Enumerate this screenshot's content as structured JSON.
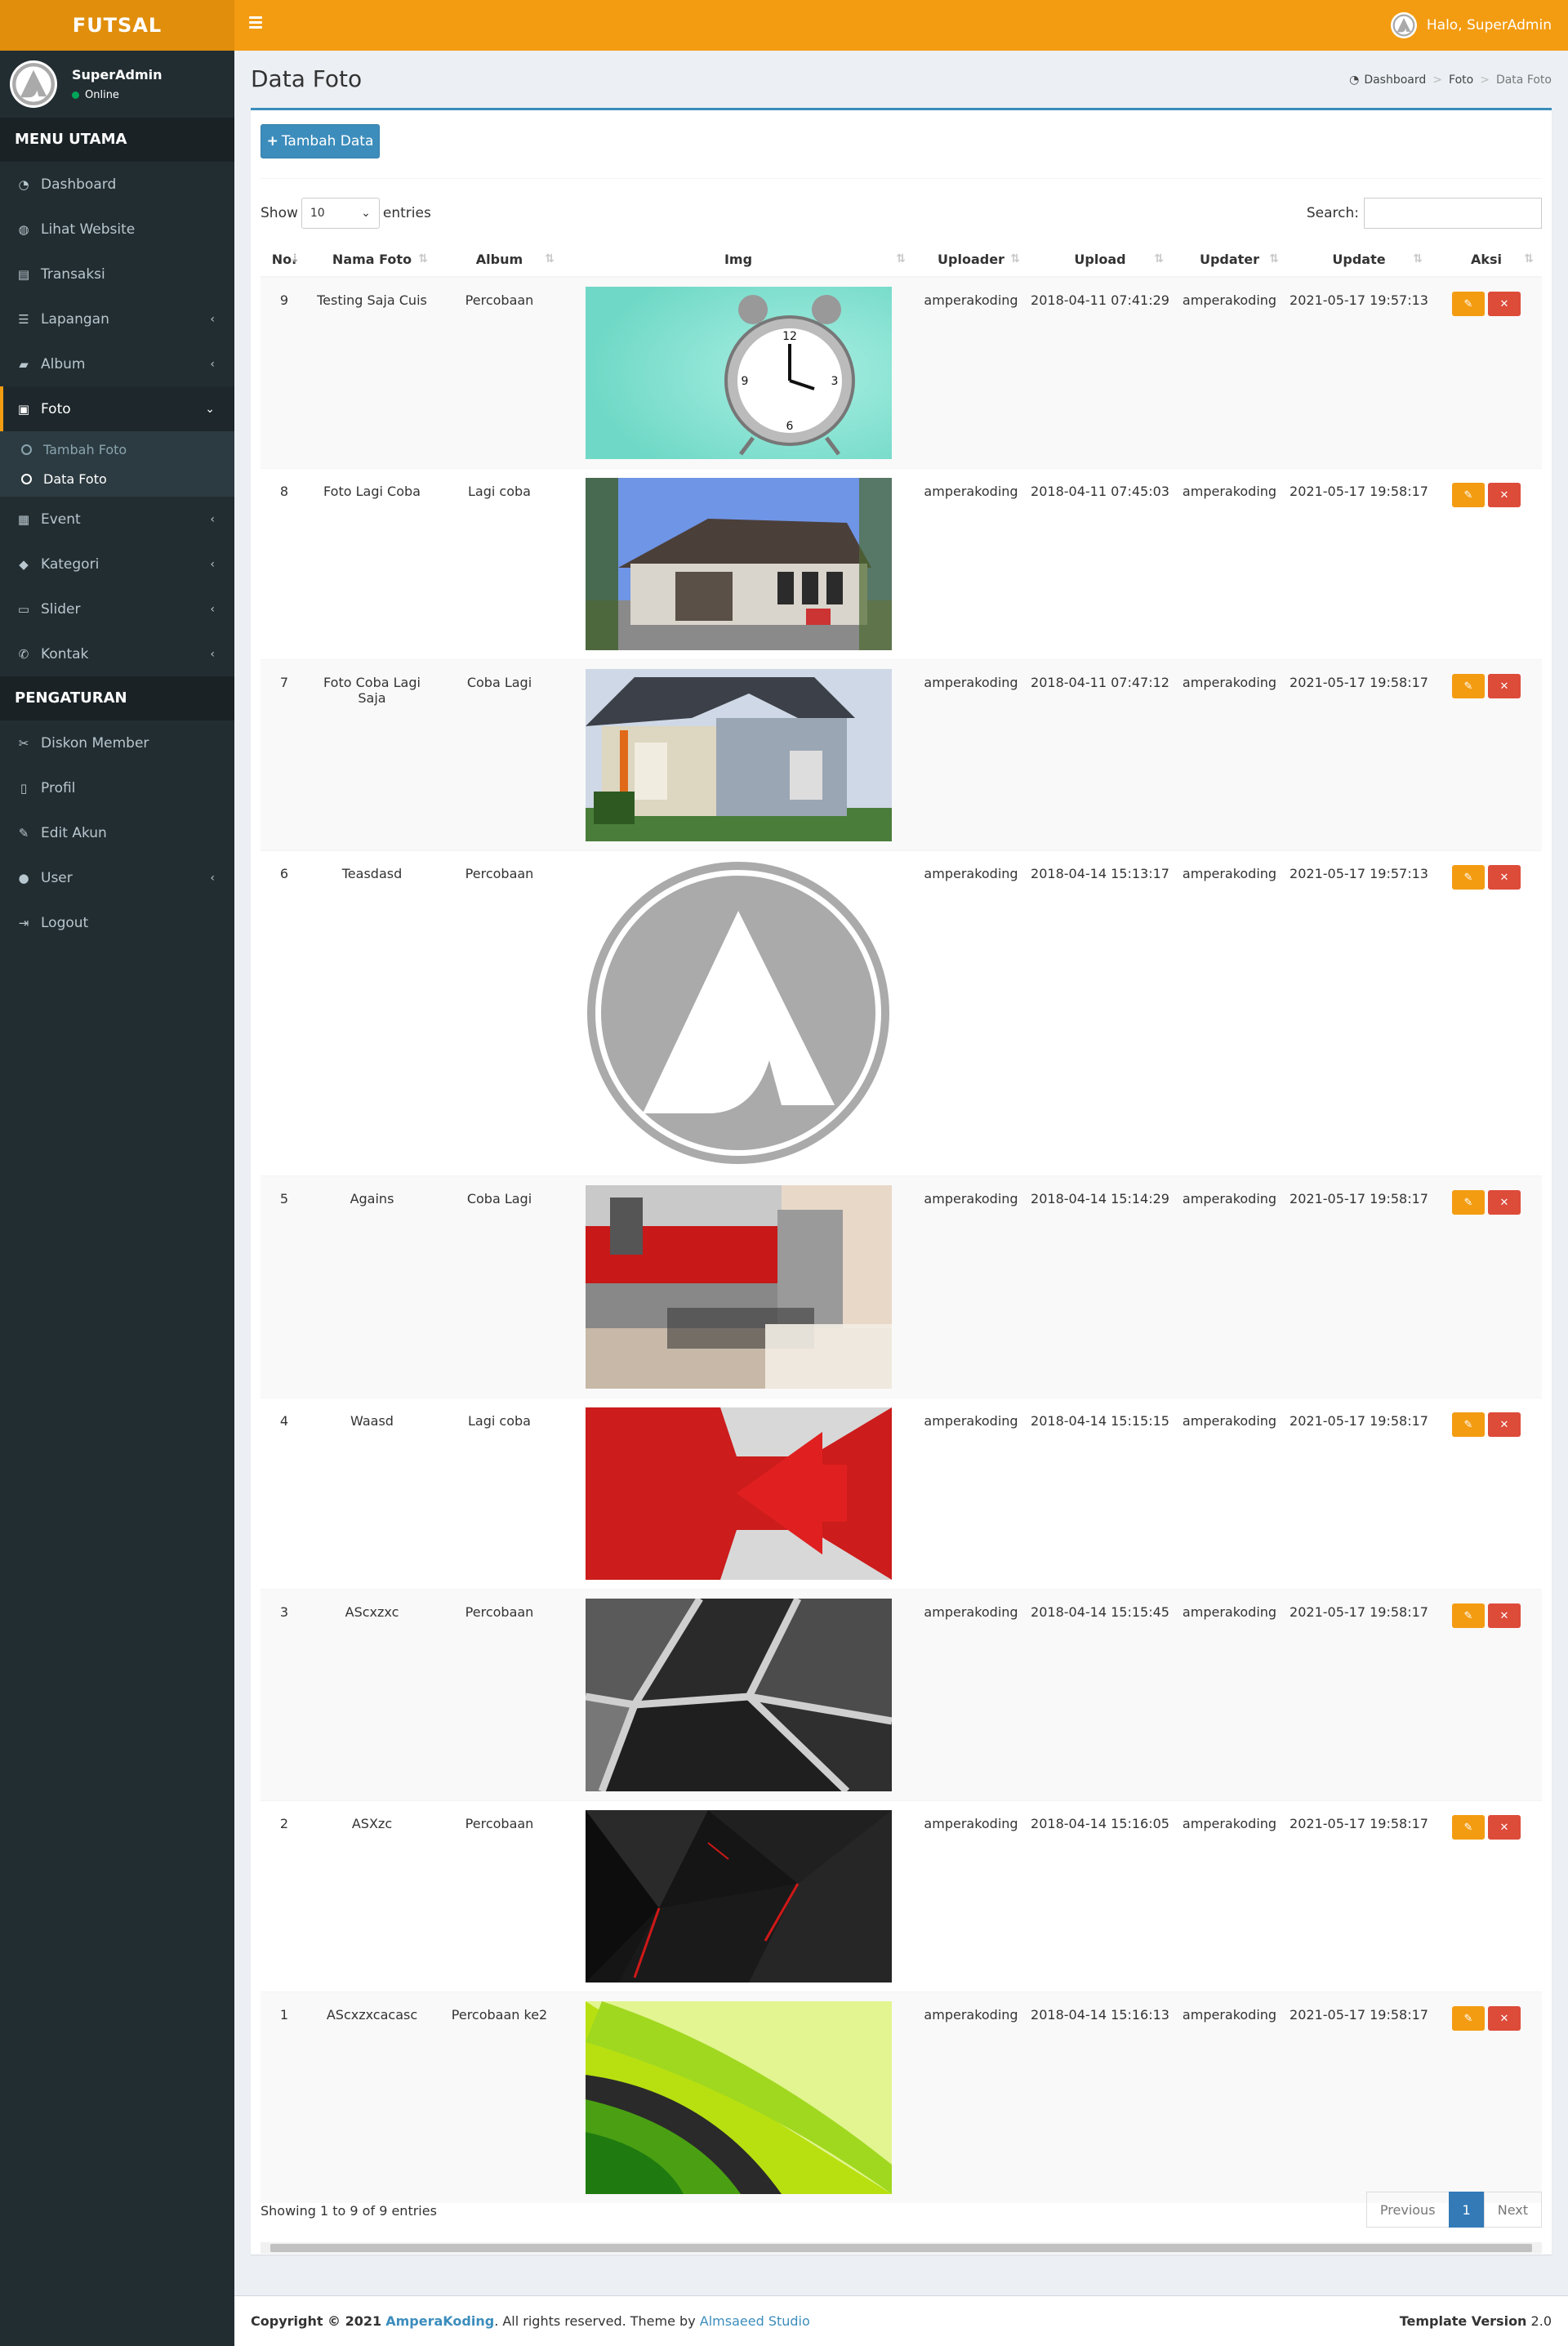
{
  "app": {
    "logo": "FUTSAL",
    "user_greeting": "Halo, SuperAdmin"
  },
  "sidebar": {
    "user_name": "SuperAdmin",
    "user_status": "Online",
    "main_header": "MENU UTAMA",
    "items": [
      {
        "label": "Dashboard",
        "icon": "dashboard-icon"
      },
      {
        "label": "Lihat Website",
        "icon": "globe-icon"
      },
      {
        "label": "Transaksi",
        "icon": "book-icon"
      },
      {
        "label": "Lapangan",
        "icon": "list-icon"
      },
      {
        "label": "Album",
        "icon": "folder-icon"
      },
      {
        "label": "Foto",
        "icon": "image-icon"
      },
      {
        "label": "Event",
        "icon": "newspaper-icon"
      },
      {
        "label": "Kategori",
        "icon": "tag-icon"
      },
      {
        "label": "Slider",
        "icon": "credit-card-icon"
      },
      {
        "label": "Kontak",
        "icon": "phone-icon"
      }
    ],
    "foto_sub": [
      "Tambah Foto",
      "Data Foto"
    ],
    "settings_header": "PENGATURAN",
    "settings": [
      {
        "label": "Diskon Member",
        "icon": "scissors-icon"
      },
      {
        "label": "Profil",
        "icon": "file-icon"
      },
      {
        "label": "Edit Akun",
        "icon": "edit-icon"
      },
      {
        "label": "User",
        "icon": "user-icon"
      },
      {
        "label": "Logout",
        "icon": "sign-out-icon"
      }
    ]
  },
  "page": {
    "title": "Data Foto",
    "breadcrumb": [
      "Dashboard",
      "Foto",
      "Data Foto"
    ],
    "add_button": "Tambah Data",
    "show_label": "Show",
    "entries_value": "10",
    "entries_label": "entries",
    "search_label": "Search:"
  },
  "table": {
    "columns": [
      "No.",
      "Nama Foto",
      "Album",
      "Img",
      "Uploader",
      "Upload",
      "Updater",
      "Update",
      "Aksi"
    ],
    "rows": [
      {
        "no": "9",
        "nama": "Testing Saja Cuis",
        "album": "Percobaan",
        "img": "alarm-clock",
        "uploader": "amperakoding",
        "upload": "2018-04-11 07:41:29",
        "updater": "amperakoding",
        "update": "2021-05-17 19:57:13"
      },
      {
        "no": "8",
        "nama": "Foto Lagi Coba",
        "album": "Lagi coba",
        "img": "house-dark",
        "uploader": "amperakoding",
        "upload": "2018-04-11 07:45:03",
        "updater": "amperakoding",
        "update": "2021-05-17 19:58:17"
      },
      {
        "no": "7",
        "nama": "Foto Coba Lagi Saja",
        "album": "Coba Lagi",
        "img": "house-grey",
        "uploader": "amperakoding",
        "upload": "2018-04-11 07:47:12",
        "updater": "amperakoding",
        "update": "2021-05-17 19:58:17"
      },
      {
        "no": "6",
        "nama": "Teasdasd",
        "album": "Percobaan",
        "img": "logo",
        "uploader": "amperakoding",
        "upload": "2018-04-14 15:13:17",
        "updater": "amperakoding",
        "update": "2021-05-17 19:57:13"
      },
      {
        "no": "5",
        "nama": "Agains",
        "album": "Coba Lagi",
        "img": "kitchen",
        "uploader": "amperakoding",
        "upload": "2018-04-14 15:14:29",
        "updater": "amperakoding",
        "update": "2021-05-17 19:58:17"
      },
      {
        "no": "4",
        "nama": "Waasd",
        "album": "Lagi coba",
        "img": "red-arrow",
        "uploader": "amperakoding",
        "upload": "2018-04-14 15:15:15",
        "updater": "amperakoding",
        "update": "2021-05-17 19:58:17"
      },
      {
        "no": "3",
        "nama": "AScxzxc",
        "album": "Percobaan",
        "img": "grey-abstract",
        "uploader": "amperakoding",
        "upload": "2018-04-14 15:15:45",
        "updater": "amperakoding",
        "update": "2021-05-17 19:58:17"
      },
      {
        "no": "2",
        "nama": "ASXzc",
        "album": "Percobaan",
        "img": "dark-poly",
        "uploader": "amperakoding",
        "upload": "2018-04-14 15:16:05",
        "updater": "amperakoding",
        "update": "2021-05-17 19:58:17"
      },
      {
        "no": "1",
        "nama": "AScxzxcacasc",
        "album": "Percobaan ke2",
        "img": "green-wave",
        "uploader": "amperakoding",
        "upload": "2018-04-14 15:16:13",
        "updater": "amperakoding",
        "update": "2021-05-17 19:58:17"
      }
    ]
  },
  "pagination": {
    "info": "Showing 1 to 9 of 9 entries",
    "previous": "Previous",
    "current": "1",
    "next": "Next"
  },
  "footer": {
    "copyright": "Copyright © 2021",
    "brand": "AmperaKoding",
    "rights": ". All rights reserved. Theme by",
    "theme_author": "Almsaeed Studio",
    "version_label": "Template Version",
    "version": "2.0"
  },
  "colors": {
    "header": "#f39c12",
    "logo_bg": "#e08e0b",
    "sidebar": "#222d32",
    "primary": "#3c8dbc",
    "danger": "#dd4b39"
  }
}
